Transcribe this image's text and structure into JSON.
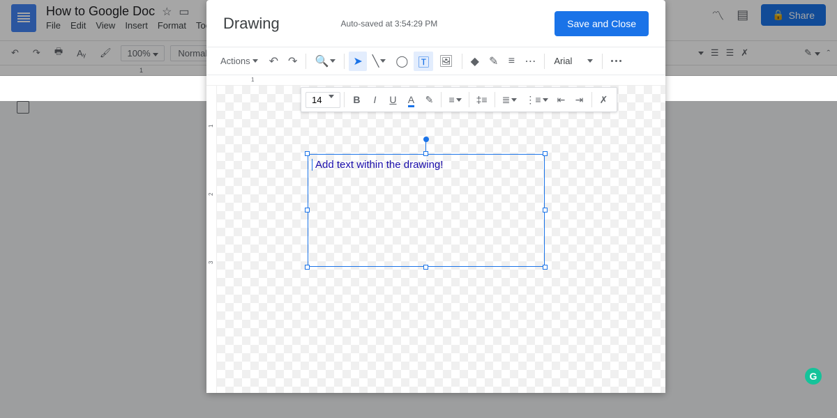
{
  "background": {
    "doc_title": "How to Google Doc",
    "menus": [
      "File",
      "Edit",
      "View",
      "Insert",
      "Format",
      "Tools"
    ],
    "toolbar": {
      "zoom": "100%",
      "style": "Normal text"
    },
    "share_label": "Share",
    "ruler_mark": "1"
  },
  "modal": {
    "title": "Drawing",
    "autosave": "Auto-saved at 3:54:29 PM",
    "save_label": "Save and Close",
    "actions_label": "Actions",
    "font_family": "Arial"
  },
  "float_toolbar": {
    "font_size": "14"
  },
  "textbox": {
    "content": "Add text within the drawing!"
  },
  "ruler_h": {
    "tick1": "1"
  },
  "ruler_v": {
    "tick1": "1",
    "tick2": "2",
    "tick3": "3"
  }
}
